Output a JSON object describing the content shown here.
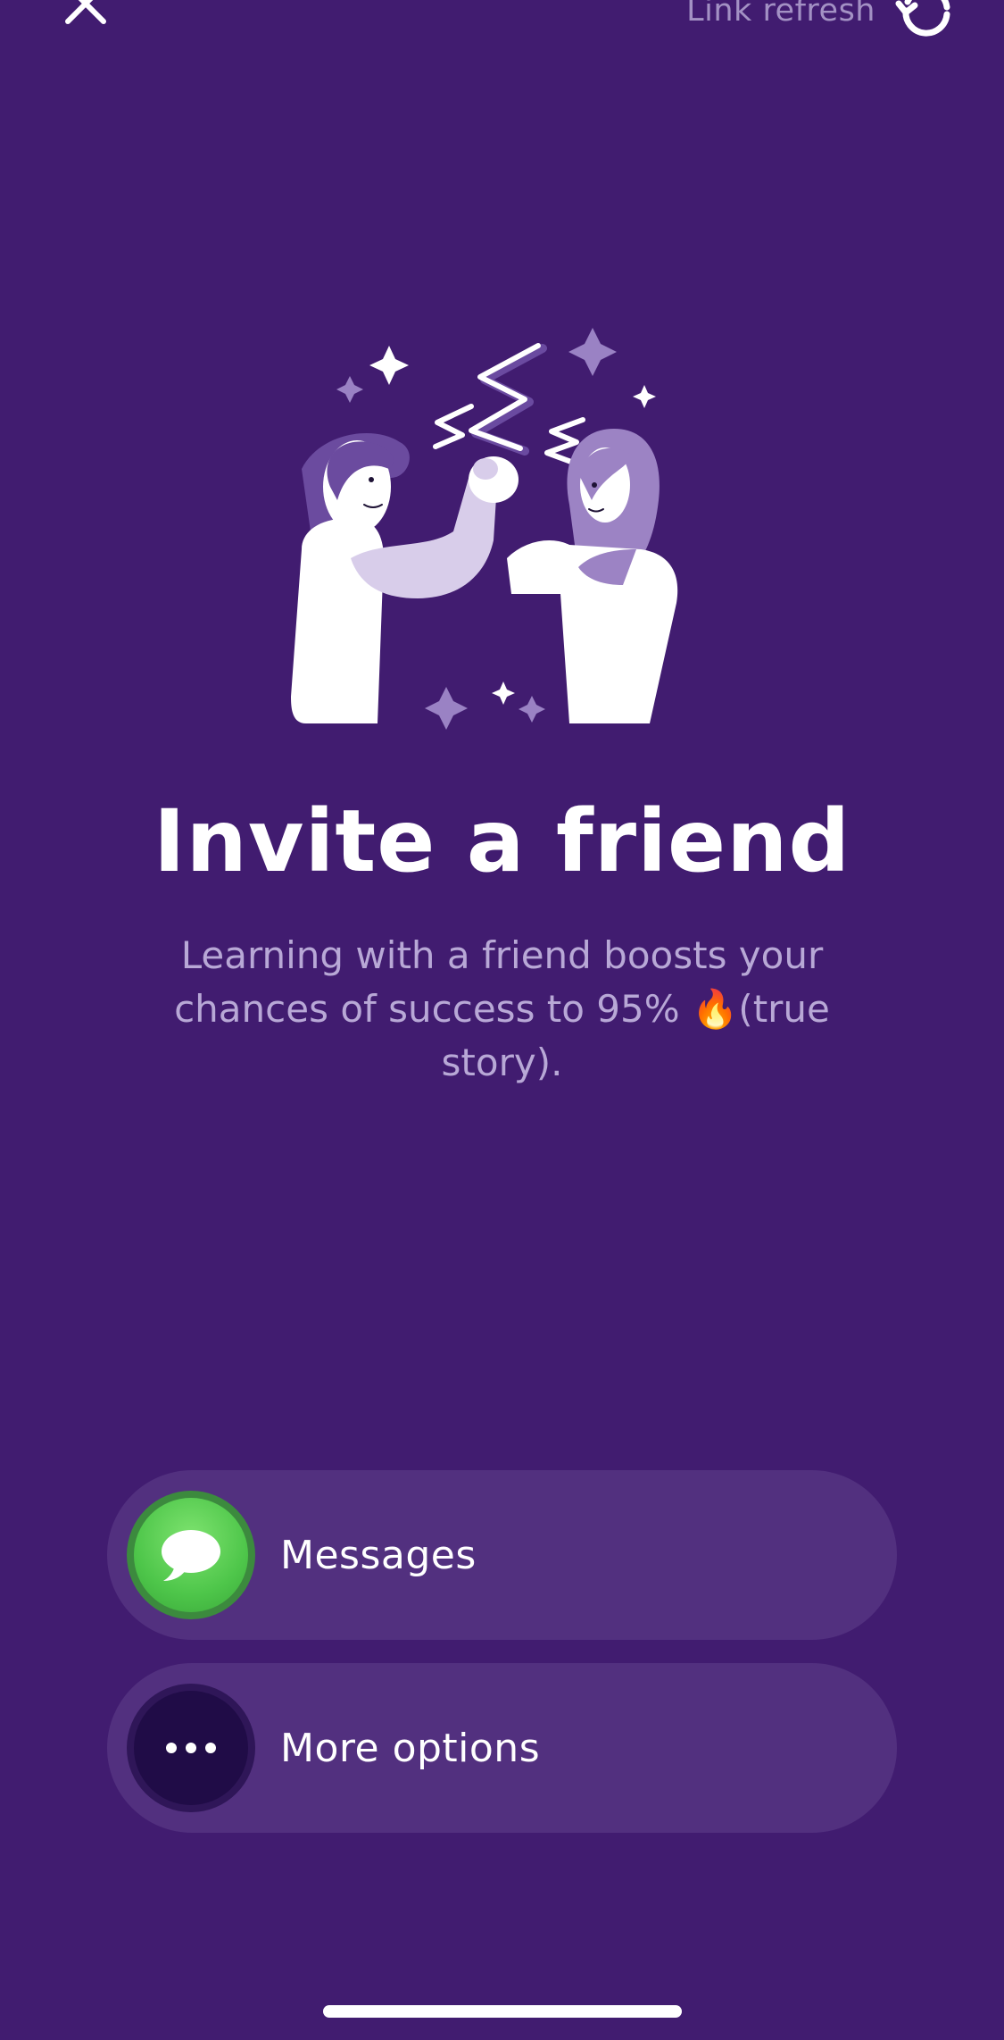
{
  "header": {
    "refresh_label": "Link refresh"
  },
  "hero": {
    "title": "Invite a friend",
    "subtitle": "Learning with a friend boosts your chances of success to 95% 🔥(true story)."
  },
  "share_options": [
    {
      "label": "Messages",
      "icon": "messages-app-icon"
    },
    {
      "label": "More options",
      "icon": "more-options-icon"
    }
  ],
  "colors": {
    "background": "#411c70",
    "button_background": "#52307f",
    "subtitle": "#b8a8d6",
    "messages_green": "#4ec64a"
  }
}
